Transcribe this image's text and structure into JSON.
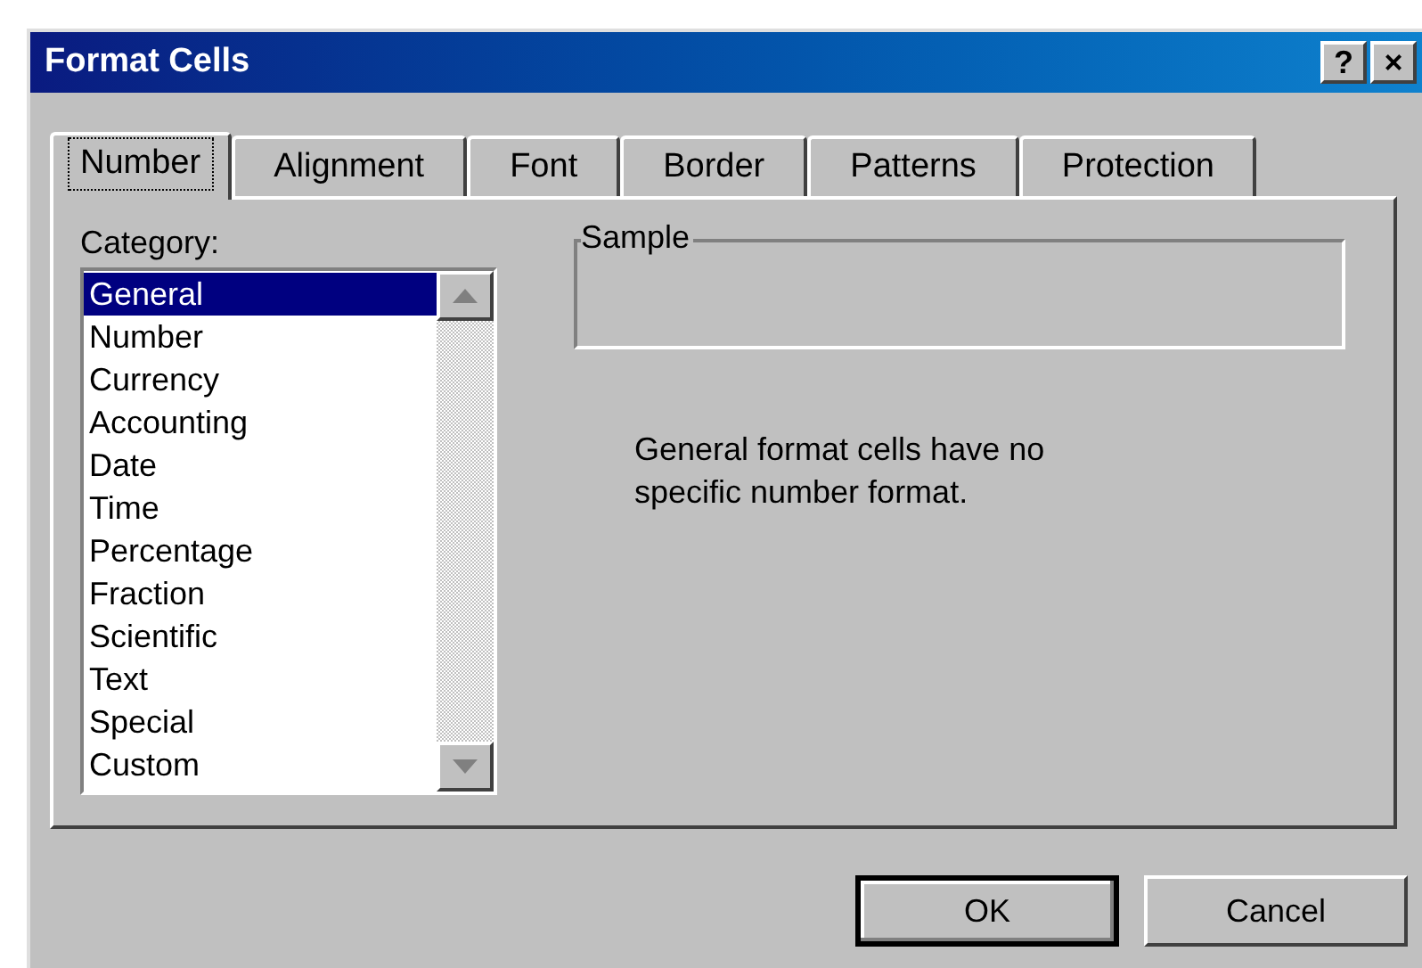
{
  "window": {
    "title": "Format Cells",
    "title_buttons": [
      "?",
      "×"
    ]
  },
  "tabs": [
    {
      "label": "Number",
      "selected": true
    },
    {
      "label": "Alignment",
      "selected": false
    },
    {
      "label": "Font",
      "selected": false
    },
    {
      "label": "Border",
      "selected": false
    },
    {
      "label": "Patterns",
      "selected": false
    },
    {
      "label": "Protection",
      "selected": false
    }
  ],
  "category": {
    "label": "Category:",
    "items": [
      {
        "label": "General",
        "selected": true
      },
      {
        "label": "Number",
        "selected": false
      },
      {
        "label": "Currency",
        "selected": false
      },
      {
        "label": "Accounting",
        "selected": false
      },
      {
        "label": "Date",
        "selected": false
      },
      {
        "label": "Time",
        "selected": false
      },
      {
        "label": "Percentage",
        "selected": false
      },
      {
        "label": "Fraction",
        "selected": false
      },
      {
        "label": "Scientific",
        "selected": false
      },
      {
        "label": "Text",
        "selected": false
      },
      {
        "label": "Special",
        "selected": false
      },
      {
        "label": "Custom",
        "selected": false
      }
    ]
  },
  "sample": {
    "label": "Sample"
  },
  "description": "General format cells have no specific number format.",
  "buttons": [
    {
      "label": "OK",
      "default": true
    },
    {
      "label": "Cancel",
      "default": false
    }
  ]
}
